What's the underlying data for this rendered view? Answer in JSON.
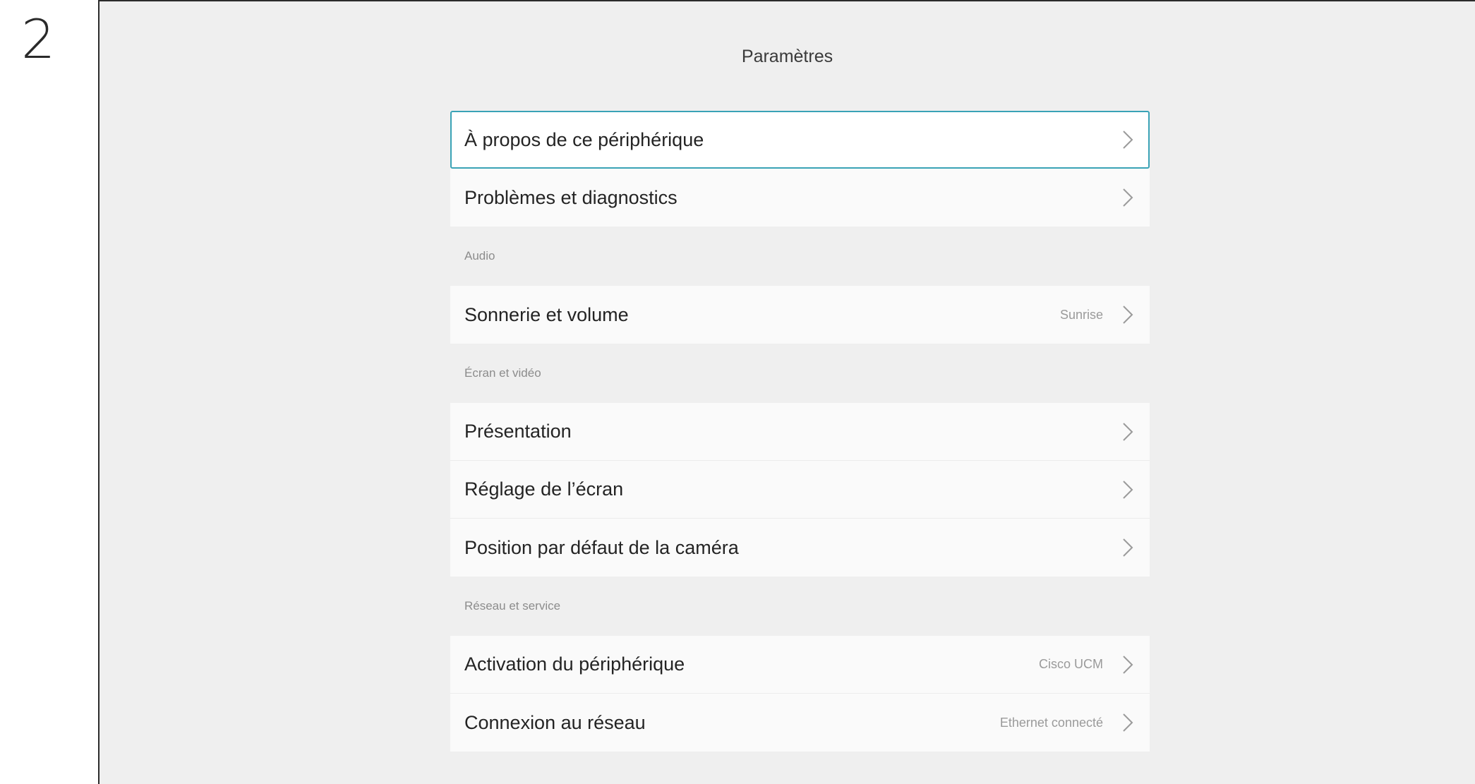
{
  "step": "2",
  "header": {
    "title": "Paramètres"
  },
  "groups": [
    {
      "section_label": "",
      "items": [
        {
          "label": "À propos de ce périphérique",
          "value": ""
        },
        {
          "label": "Problèmes et diagnostics",
          "value": ""
        }
      ]
    },
    {
      "section_label": "Audio",
      "items": [
        {
          "label": "Sonnerie et volume",
          "value": "Sunrise"
        }
      ]
    },
    {
      "section_label": "Écran et vidéo",
      "items": [
        {
          "label": "Présentation",
          "value": ""
        },
        {
          "label": "Réglage de l’écran",
          "value": ""
        },
        {
          "label": "Position par défaut de la caméra",
          "value": ""
        }
      ]
    },
    {
      "section_label": "Réseau et service",
      "items": [
        {
          "label": "Activation du périphérique",
          "value": "Cisco UCM"
        },
        {
          "label": "Connexion au réseau",
          "value": "Ethernet connecté"
        }
      ]
    }
  ],
  "colors": {
    "focus_border": "#3aa3b6",
    "background": "#efefef",
    "row_background": "#fafafa"
  },
  "icons": {
    "row_chevron": "chevron-right-icon"
  }
}
